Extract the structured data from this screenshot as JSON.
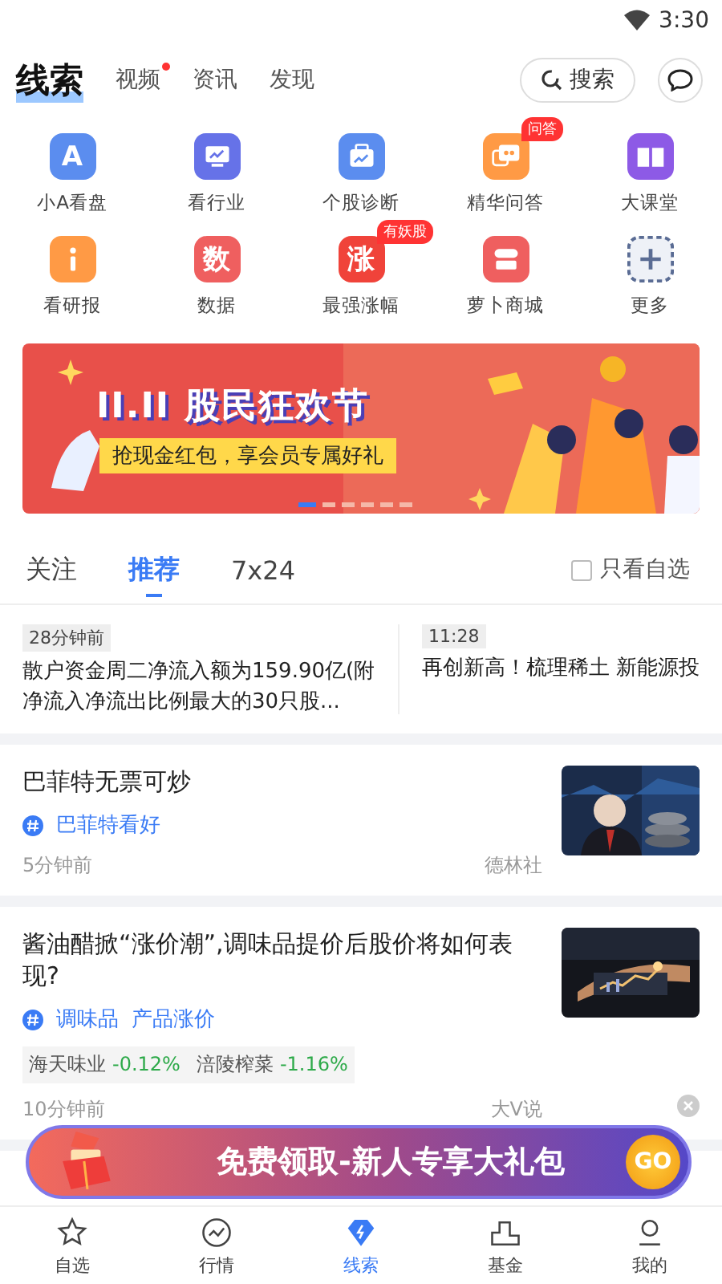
{
  "status_bar": {
    "time": "3:30"
  },
  "header": {
    "tabs": [
      {
        "label": "线索",
        "selected": true,
        "dot": false
      },
      {
        "label": "视频",
        "selected": false,
        "dot": true
      },
      {
        "label": "资讯",
        "selected": false,
        "dot": false
      },
      {
        "label": "发现",
        "selected": false,
        "dot": false
      }
    ],
    "search": "搜索"
  },
  "shortcuts": [
    {
      "label": "小A看盘",
      "kind": "glyph",
      "glyph": "A",
      "color": "#5b8def"
    },
    {
      "label": "看行业",
      "kind": "monitor",
      "color": "#6672e8"
    },
    {
      "label": "个股诊断",
      "kind": "briefcase",
      "color": "#5b8def"
    },
    {
      "label": "精华问答",
      "kind": "chat",
      "color": "#ff9a45",
      "badge": "问答"
    },
    {
      "label": "大课堂",
      "kind": "book",
      "color": "#8d5ae6"
    },
    {
      "label": "看研报",
      "kind": "info",
      "color": "#ff9a45"
    },
    {
      "label": "数据",
      "kind": "glyph",
      "glyph": "数",
      "color": "#ef5f5f"
    },
    {
      "label": "最强涨幅",
      "kind": "glyph",
      "glyph": "涨",
      "color": "#f0433a",
      "badge": "有妖股"
    },
    {
      "label": "萝卜商城",
      "kind": "shop",
      "color": "#ef5f5f"
    },
    {
      "label": "更多",
      "kind": "more",
      "color": "#5a6c94"
    }
  ],
  "banner": {
    "title": "II.II 股民狂欢节",
    "subtitle": "抢现金红包，享会员专属好礼",
    "pages": [
      {
        "selected": true
      },
      {
        "selected": false
      },
      {
        "selected": false
      },
      {
        "selected": false
      },
      {
        "selected": false
      },
      {
        "selected": false
      }
    ]
  },
  "feed_tabs": [
    {
      "label": "关注",
      "selected": false
    },
    {
      "label": "推荐",
      "selected": true
    },
    {
      "label": "7x24",
      "selected": false
    }
  ],
  "watchlist_filter": {
    "label": "只看自选",
    "checked": false
  },
  "flash_news": [
    {
      "time": "28分钟前",
      "text": "散户资金周二净流入额为159.90亿(附净流入净流出比例最大的30只股..."
    },
    {
      "time": "11:28",
      "text": "再创新高！梳理稀土 新能源投"
    }
  ],
  "articles": [
    {
      "title": "巴菲特无票可炒",
      "tags": [
        "巴菲特看好"
      ],
      "time": "5分钟前",
      "source": "德林社"
    },
    {
      "title": "酱油醋掀“涨价潮”,调味品提价后股价将如何表现?",
      "tags": [
        "调味品",
        "产品涨价"
      ],
      "stocks": [
        {
          "name": "海天味业",
          "change": "-0.12%"
        },
        {
          "name": "涪陵榨菜",
          "change": "-1.16%"
        }
      ],
      "time": "10分钟前",
      "source": "大V说"
    }
  ],
  "promo": {
    "text": "免费领取-新人专享大礼包",
    "button": "GO"
  },
  "bottom_nav": [
    {
      "label": "自选",
      "kind": "star",
      "selected": false
    },
    {
      "label": "行情",
      "kind": "chart",
      "selected": false
    },
    {
      "label": "线索",
      "kind": "bolt",
      "selected": true
    },
    {
      "label": "基金",
      "kind": "podium",
      "selected": false
    },
    {
      "label": "我的",
      "kind": "person",
      "selected": false
    }
  ]
}
